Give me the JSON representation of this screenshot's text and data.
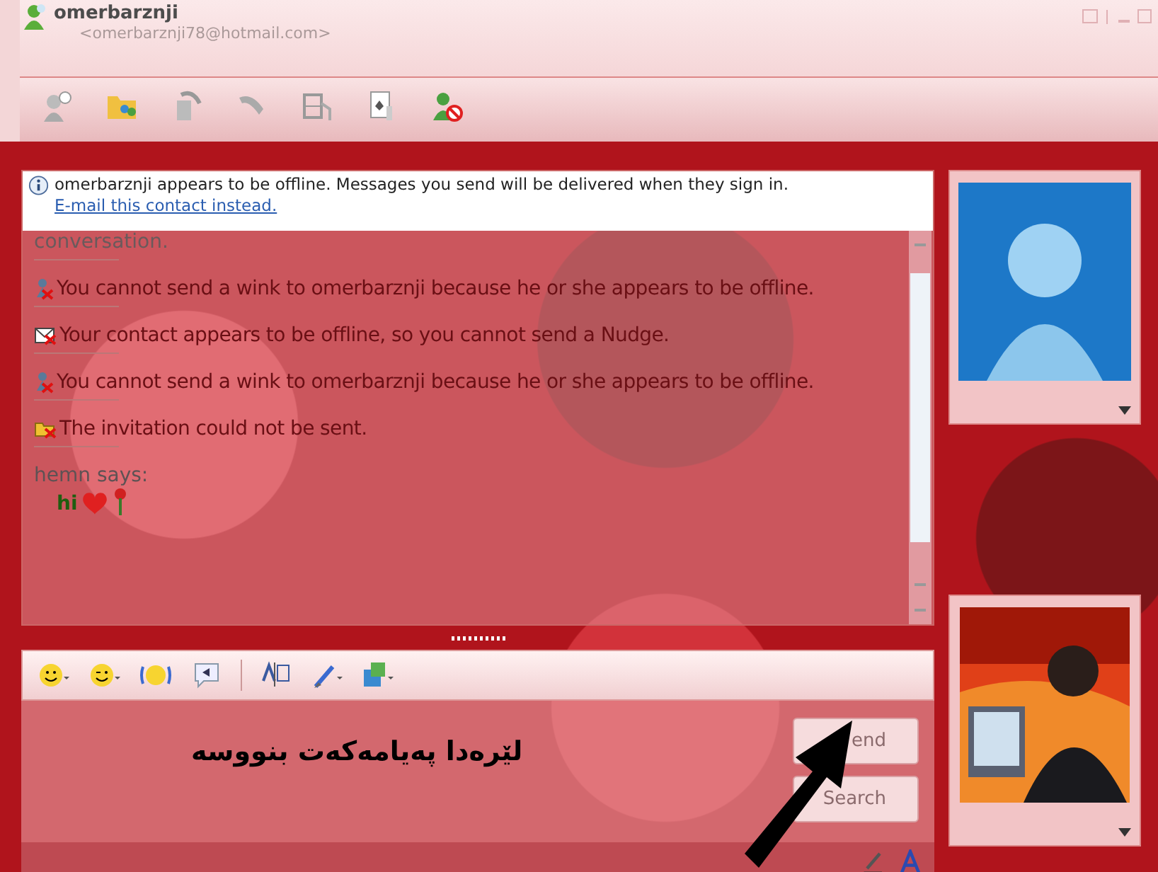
{
  "contact": {
    "name": "omerbarznji",
    "email": "<omerbarznji78@hotmail.com>"
  },
  "info_bar": {
    "text": "omerbarznji appears to be offline. Messages you send will be delivered when they sign in.",
    "link": "E-mail this contact instead."
  },
  "conversation": {
    "cut_line": "conversation.",
    "notices": [
      {
        "kind": "wink",
        "text": "You cannot send a wink to omerbarznji because he or she appears to be offline."
      },
      {
        "kind": "nudge",
        "text": "Your contact appears to be offline, so you cannot send a Nudge."
      },
      {
        "kind": "wink",
        "text": "You cannot send a wink to omerbarznji because he or she appears to be offline."
      },
      {
        "kind": "invite",
        "text": "The invitation could not be sent."
      }
    ],
    "sender": "hemn says:",
    "message": "hi"
  },
  "buttons": [
    {
      "label": "end",
      "disabled": true
    },
    {
      "label": "Search",
      "disabled": true
    }
  ],
  "annotation": "لێرەدا پەیامەکەت بنووسە"
}
